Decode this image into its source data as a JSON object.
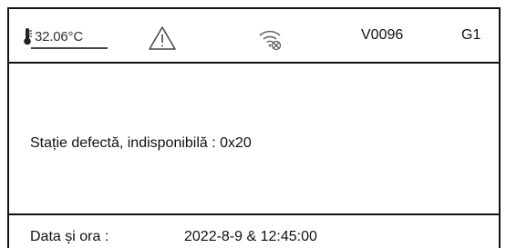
{
  "status_bar": {
    "temperature": "32.06°C",
    "temperature_icon": "thermometer-icon",
    "warning_icon": "warning-triangle-icon",
    "wifi_icon": "wifi-disconnected-icon",
    "version": "V0096",
    "group": "G1"
  },
  "main": {
    "message": "Stație defectă, indisponibilă : 0x20"
  },
  "footer": {
    "datetime_label": "Data și ora :",
    "datetime_value": "2022-8-9 & 12:45:00"
  },
  "colors": {
    "text": "#111111",
    "background": "#ffffff"
  }
}
